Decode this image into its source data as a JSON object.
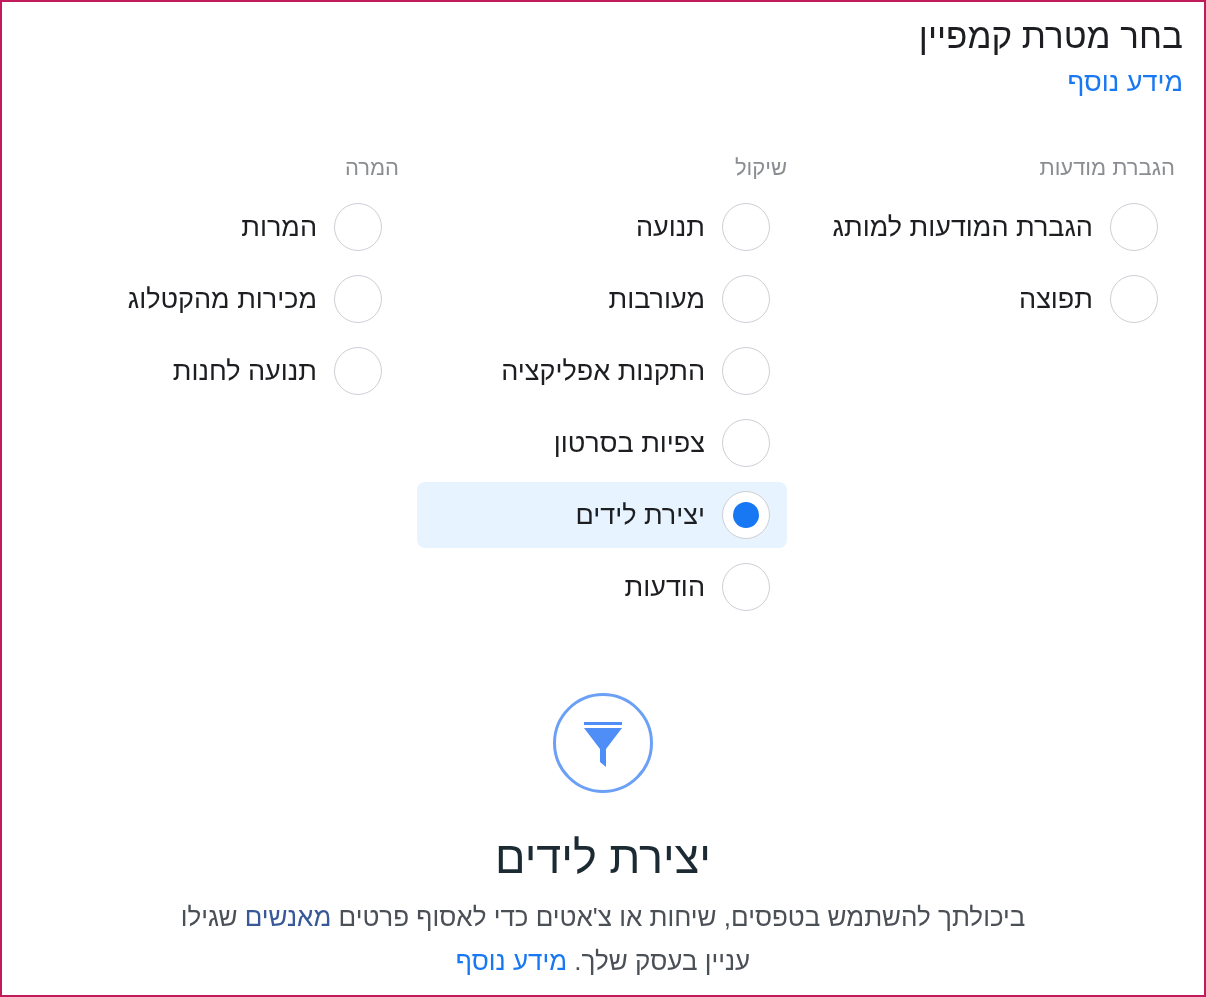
{
  "header": {
    "title": "בחר מטרת קמפיין",
    "learn_more": "מידע נוסף"
  },
  "objective_groups": [
    {
      "heading": "הגברת מודעות",
      "options": [
        {
          "label": "הגברת המודעות למותג",
          "selected": false
        },
        {
          "label": "תפוצה",
          "selected": false
        }
      ]
    },
    {
      "heading": "שיקול",
      "options": [
        {
          "label": "תנועה",
          "selected": false
        },
        {
          "label": "מעורבות",
          "selected": false
        },
        {
          "label": "התקנות אפליקציה",
          "selected": false
        },
        {
          "label": "צפיות בסרטון",
          "selected": false
        },
        {
          "label": "יצירת לידים",
          "selected": true
        },
        {
          "label": "הודעות",
          "selected": false
        }
      ]
    },
    {
      "heading": "המרה",
      "options": [
        {
          "label": "המרות",
          "selected": false
        },
        {
          "label": "מכירות מהקטלוג",
          "selected": false
        },
        {
          "label": "תנועה לחנות",
          "selected": false
        }
      ]
    }
  ],
  "selected_objective": {
    "title": "יצירת לידים",
    "description": {
      "text_before": "ביכולתך להשתמש בטפסים, שיחות או צ'אטים כדי לאסוף פרטים",
      "link": "מאנשים",
      "text_after": "שגילו עניין בעסק שלך.",
      "learn_more": "מידע נוסף"
    }
  }
}
